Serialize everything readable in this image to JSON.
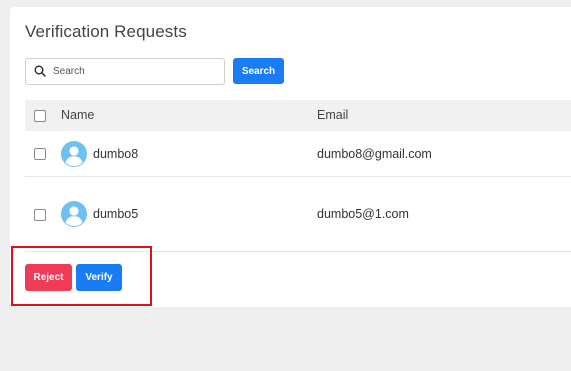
{
  "page": {
    "title": "Verification Requests"
  },
  "search": {
    "placeholder": "Search",
    "value": "",
    "button_label": "Search"
  },
  "table": {
    "columns": [
      "Name",
      "Email"
    ],
    "rows": [
      {
        "name": "dumbo8",
        "email": "dumbo8@gmail.com"
      },
      {
        "name": "dumbo5",
        "email": "dumbo5@1.com"
      }
    ]
  },
  "actions": {
    "reject_label": "Reject",
    "verify_label": "Verify"
  },
  "colors": {
    "primary": "#1a7cf5",
    "danger": "#ef3b55",
    "avatar": "#6ec0f2",
    "highlight": "#e0101a"
  }
}
